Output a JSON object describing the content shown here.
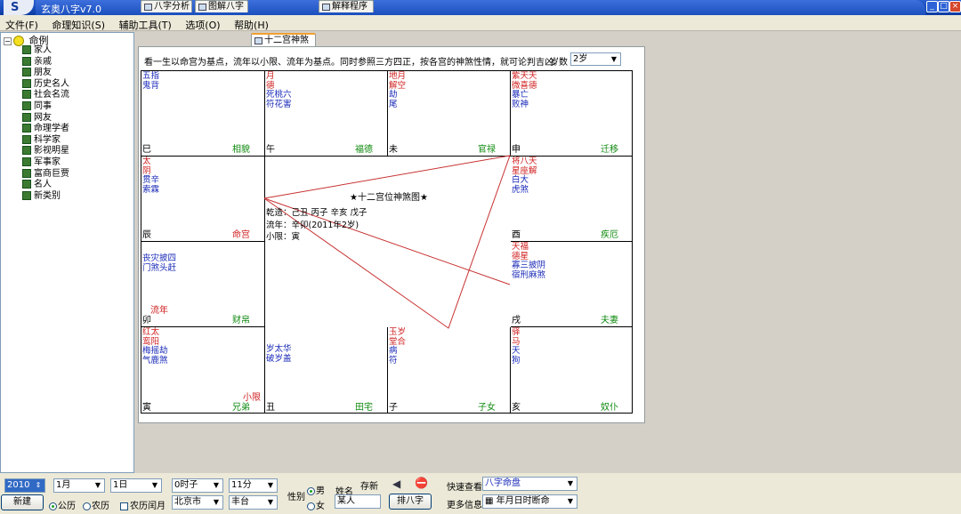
{
  "window": {
    "title": "玄奥八字v7.0",
    "app_icon": "S"
  },
  "menu": [
    "文件(F)",
    "命理知识(S)",
    "辅助工具(T)",
    "选项(O)",
    "帮助(H)"
  ],
  "tree": {
    "root": "命例",
    "items": [
      "家人",
      "亲戚",
      "朋友",
      "历史名人",
      "社会名流",
      "同事",
      "网友",
      "命理学者",
      "科学家",
      "影视明星",
      "军事家",
      "富商巨贾",
      "名人",
      "新类别"
    ]
  },
  "tabs": [
    "八字分析",
    "图解八字",
    "十二宫神煞",
    "解释程序"
  ],
  "hint": "看一生以命宫为基点，流年以小限、流年为基点。同时参照三方四正，按各宫的神煞性情，就可论判吉凶。",
  "age": {
    "label": "岁数",
    "value": "2岁"
  },
  "cells": {
    "si": {
      "red": [],
      "blue": [
        "五指",
        "鬼背"
      ],
      "branch": "巳",
      "palace": "相貌"
    },
    "wu": {
      "red": [
        "月",
        "德"
      ],
      "blue": [
        "死桃六",
        "符花害"
      ],
      "branch": "午",
      "palace": "福德"
    },
    "wei": {
      "red": [
        "地月",
        "解空"
      ],
      "blue": [
        "劫",
        "尾"
      ],
      "branch": "未",
      "palace": "官禄"
    },
    "shen": {
      "red": [
        "紫天天",
        "微喜德"
      ],
      "blue": [
        "暴亡",
        "败神"
      ],
      "branch": "申",
      "palace": "迁移"
    },
    "chen": {
      "red": [
        "太",
        "阴"
      ],
      "blue": [
        "贯辛",
        "索霖"
      ],
      "branch": "辰",
      "palace": "命宫"
    },
    "you": {
      "red": [
        "将八天",
        "星座解"
      ],
      "blue": [
        "白大",
        "虎煞"
      ],
      "branch": "酉",
      "palace": "疾厄"
    },
    "mao": {
      "red": [],
      "blue": [
        "丧灾披四",
        "门煞头赶"
      ],
      "branch": "卯",
      "palace": "财帛",
      "extra": "流年"
    },
    "xu": {
      "red": [
        "天福",
        "德星"
      ],
      "blue": [
        "寡三披阴",
        "宿刑麻煞"
      ],
      "branch": "戌",
      "palace": "夫妻"
    },
    "yin": {
      "red": [
        "红太",
        "鸾阳"
      ],
      "blue": [
        "梅摇劫",
        "气鹿煞"
      ],
      "branch": "寅",
      "palace": "兄弟",
      "extra": "小限"
    },
    "chou": {
      "red": [],
      "blue": [
        "岁太华",
        "破岁盖"
      ],
      "branch": "丑",
      "palace": "田宅"
    },
    "zi": {
      "red": [
        "玉岁",
        "堂合"
      ],
      "blue": [
        "病",
        "符"
      ],
      "branch": "子",
      "palace": "子女"
    },
    "hai": {
      "red": [
        "驿",
        "马"
      ],
      "blue": [
        "天",
        "狗"
      ],
      "branch": "亥",
      "palace": "奴仆"
    }
  },
  "center": {
    "title": "★十二宫位神煞图★",
    "bazi": "乾造：己丑  丙子  辛亥  戊子",
    "liunian": "流年：辛卯(2011年2岁)",
    "xiaoxian": "小限：寅"
  },
  "bottom": {
    "year": "2010",
    "month": "1月",
    "day": "1日",
    "hour": "0时子",
    "minute": "11分",
    "gender_label": "性别",
    "male": "男",
    "female": "女",
    "name_label": "姓名",
    "name_value": "某人",
    "save_label": "存新",
    "new_button": "新建",
    "solar": "公历",
    "lunar": "农历",
    "lunar_leap": "农历闰月",
    "province": "北京市",
    "district": "丰台",
    "arrange_button": "排八字",
    "quick_label": "快速查看",
    "quick_value": "八字命盘",
    "more_label": "更多信息",
    "more_value": "年月日时断命"
  },
  "colors": {
    "titlebar": "#164ab8",
    "red_star": "#d02020",
    "blue_star": "#1a2ab8",
    "palace": "#118a11",
    "lines": "#c83232"
  }
}
